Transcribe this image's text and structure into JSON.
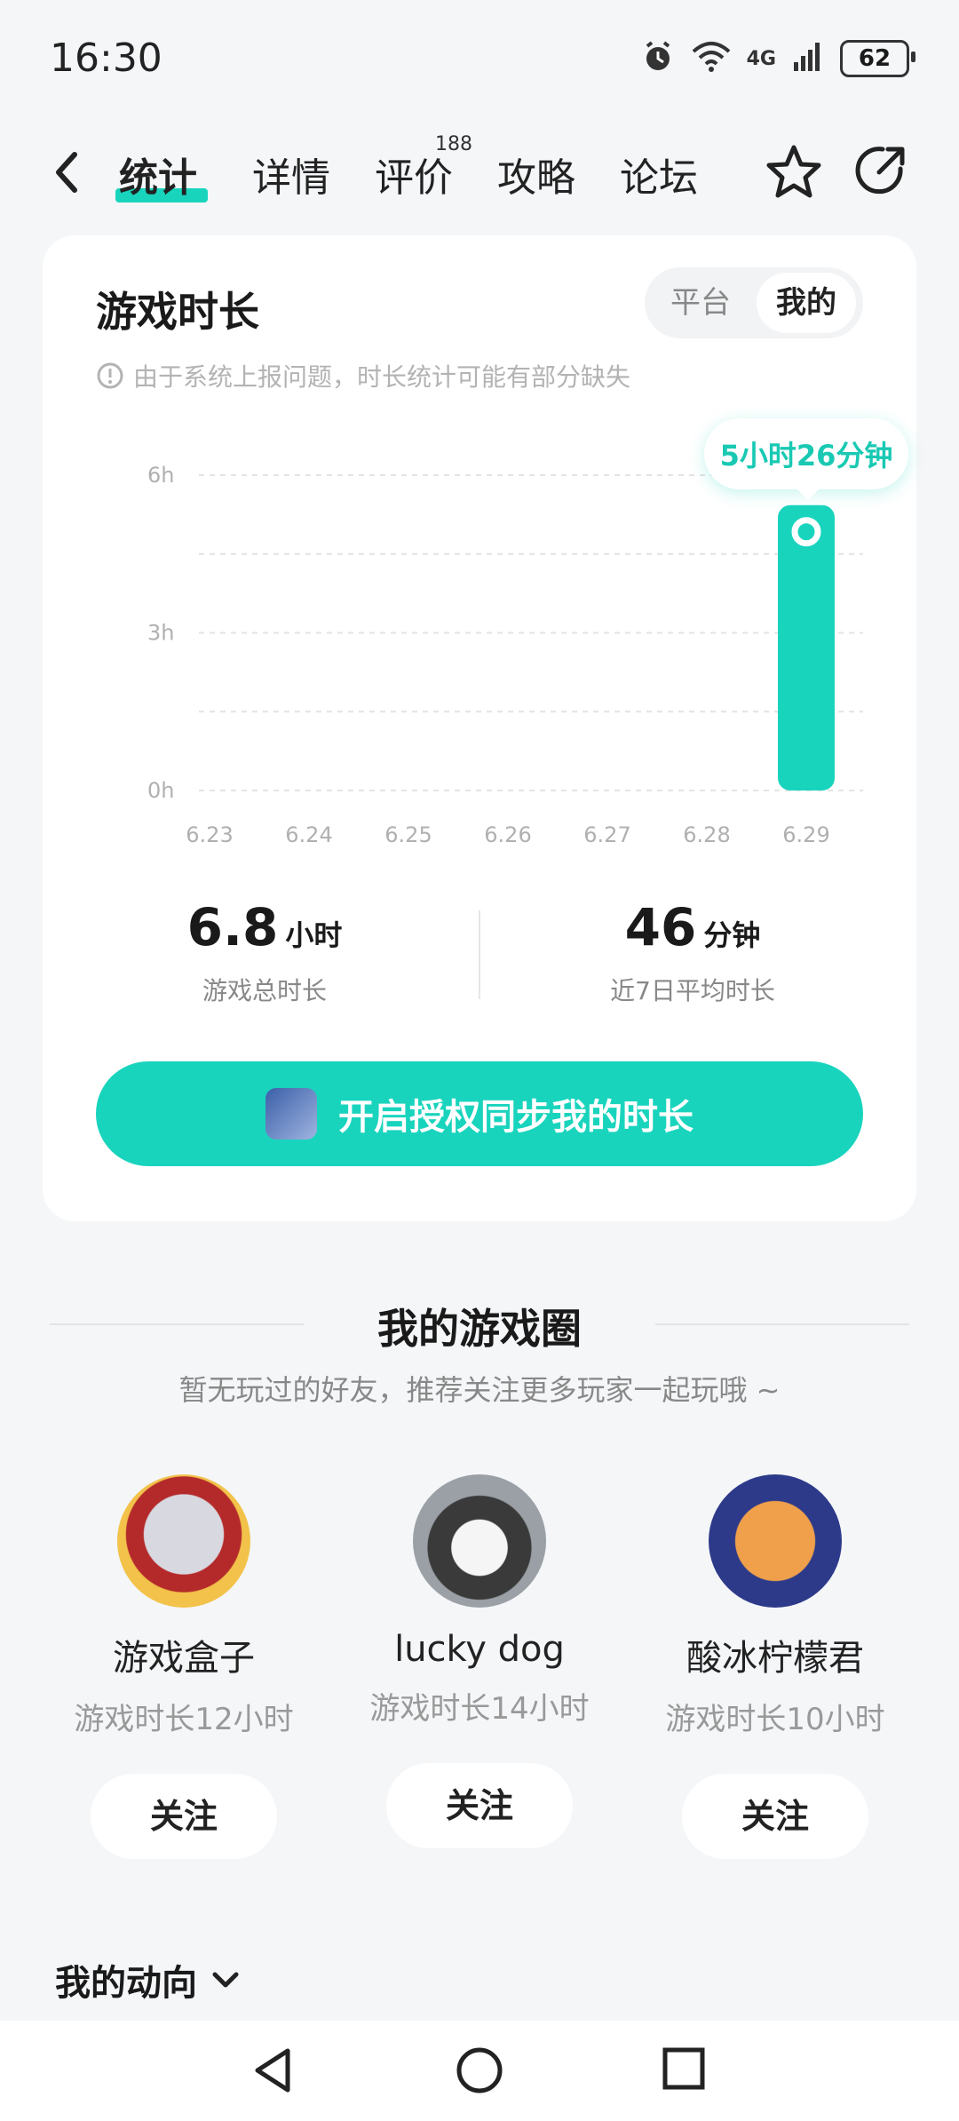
{
  "status_bar": {
    "time": "16:30",
    "network": "4G",
    "battery": "62"
  },
  "nav": {
    "tabs": [
      {
        "label": "统计"
      },
      {
        "label": "详情"
      },
      {
        "label": "评价"
      },
      {
        "label": "攻略"
      },
      {
        "label": "论坛"
      }
    ],
    "review_count": "188"
  },
  "playtime_card": {
    "title": "游戏时长",
    "toggle": {
      "platform": "平台",
      "mine": "我的"
    },
    "notice": "由于系统上报问题，时长统计可能有部分缺失",
    "tooltip": "5小时26分钟",
    "total": {
      "value": "6.8",
      "unit": "小时",
      "caption": "游戏总时长"
    },
    "average": {
      "value": "46",
      "unit": "分钟",
      "caption": "近7日平均时长"
    },
    "sync_button": "开启授权同步我的时长"
  },
  "chart_data": {
    "type": "bar",
    "categories": [
      "6.23",
      "6.24",
      "6.25",
      "6.26",
      "6.27",
      "6.28",
      "6.29"
    ],
    "values": [
      0,
      0,
      0,
      0,
      0,
      0,
      5.43
    ],
    "yticks": [
      "6h",
      "3h",
      "0h"
    ],
    "ylim": [
      0,
      6
    ],
    "grid": true,
    "color": "#19d4bd"
  },
  "game_circle": {
    "title": "我的游戏圈",
    "subtitle": "暂无玩过的好友，推荐关注更多玩家一起玩哦 ~",
    "friends": [
      {
        "name": "游戏盒子",
        "meta": "游戏时长12小时",
        "follow": "关注"
      },
      {
        "name": "lucky dog",
        "meta": "游戏时长14小时",
        "follow": "关注"
      },
      {
        "name": "酸冰柠檬君",
        "meta": "游戏时长10小时",
        "follow": "关注"
      }
    ]
  },
  "activity": {
    "label": "我的动向"
  },
  "colors": {
    "accent": "#19d4bd",
    "background": "#f4f6f8"
  }
}
